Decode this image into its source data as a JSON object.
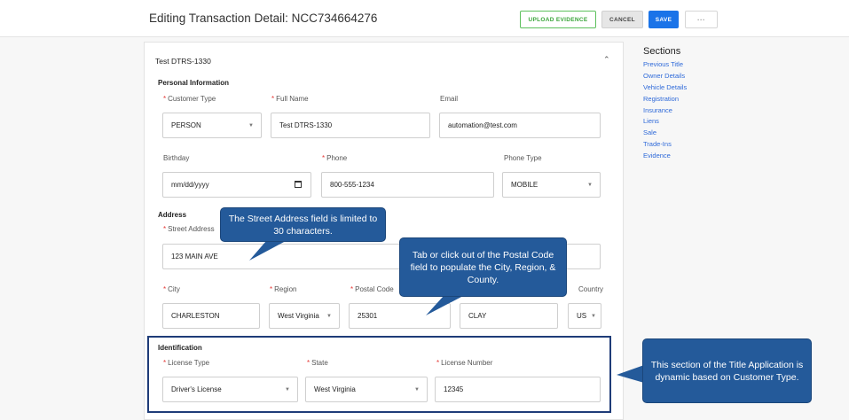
{
  "header": {
    "title": "Editing Transaction Detail: NCC734664276",
    "upload_label": "UPLOAD EVIDENCE",
    "cancel_label": "CANCEL",
    "save_label": "SAVE",
    "more_label": "···"
  },
  "card": {
    "title": "Test DTRS-1330",
    "collapse_icon": "chevron-up-icon"
  },
  "personal": {
    "heading": "Personal Information",
    "customer_type": {
      "label": "Customer Type",
      "value": "PERSON"
    },
    "full_name": {
      "label": "Full Name",
      "value": "Test DTRS-1330"
    },
    "email": {
      "label": "Email",
      "value": "automation@test.com"
    },
    "birthday": {
      "label": "Birthday",
      "value": "mm/dd/yyyy"
    },
    "phone": {
      "label": "Phone",
      "value": "800-555-1234"
    },
    "phone_type": {
      "label": "Phone Type",
      "value": "MOBILE"
    }
  },
  "address": {
    "heading": "Address",
    "street": {
      "label": "Street Address",
      "value": "123 MAIN AVE"
    },
    "city": {
      "label": "City",
      "value": "CHARLESTON"
    },
    "region": {
      "label": "Region",
      "value": "West Virginia"
    },
    "postal": {
      "label": "Postal Code",
      "value": "25301"
    },
    "county": {
      "value": "CLAY"
    },
    "country": {
      "label": "Country",
      "value": "US"
    }
  },
  "identification": {
    "heading": "Identification",
    "license_type": {
      "label": "License Type",
      "value": "Driver's License"
    },
    "state": {
      "label": "State",
      "value": "West Virginia"
    },
    "license_number": {
      "label": "License Number",
      "value": "12345"
    }
  },
  "sections_nav": {
    "title": "Sections",
    "items": [
      "Previous Title",
      "Owner Details",
      "Vehicle Details",
      "Registration",
      "Insurance",
      "Liens",
      "Sale",
      "Trade-Ins",
      "Evidence"
    ]
  },
  "callouts": {
    "street": "The Street Address field is limited to 30 characters.",
    "postal": "Tab or click out of the Postal Code field to populate the City, Region, & County.",
    "identification": "This section of the Title Application is dynamic based on Customer Type."
  },
  "colors": {
    "primary": "#1a73e8",
    "upload_green": "#3aa53a",
    "required_red": "#e53935",
    "link_blue": "#2f6ad9",
    "callout_blue": "#245a9a",
    "highlight_border": "#1f3c78"
  }
}
